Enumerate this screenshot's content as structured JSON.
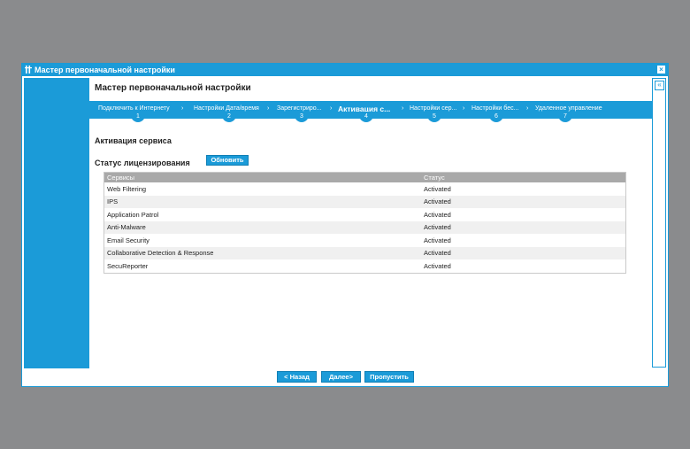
{
  "window": {
    "title": "Мастер первоначальной настройки",
    "close_glyph": "×",
    "wand_icon": "wizard-icon"
  },
  "header": {
    "title": "Мастер первоначальной настройки"
  },
  "steps": [
    {
      "label": "Подключить к Интернету",
      "number": "1"
    },
    {
      "label": "Настройки Дата/время",
      "number": "2"
    },
    {
      "label": "Зарегистриро...",
      "number": "3"
    },
    {
      "label": "Активация с...",
      "number": "4",
      "active": true
    },
    {
      "label": "Настройки сер...",
      "number": "5"
    },
    {
      "label": "Настройки бес...",
      "number": "6"
    },
    {
      "label": "Удаленное управление",
      "number": "7"
    }
  ],
  "section": {
    "title": "Активация сервиса",
    "license_label": "Статус лицензирования",
    "refresh_label": "Обновить"
  },
  "table": {
    "headers": [
      "Сервисы",
      "Статус"
    ],
    "rows": [
      [
        "Web Filtering",
        "Activated"
      ],
      [
        "IPS",
        "Activated"
      ],
      [
        "Application Patrol",
        "Activated"
      ],
      [
        "Anti-Malware",
        "Activated"
      ],
      [
        "Email Security",
        "Activated"
      ],
      [
        "Collaborative Detection & Response",
        "Activated"
      ],
      [
        "SecuReporter",
        "Activated"
      ]
    ]
  },
  "footer": {
    "back_label": "< Назад",
    "next_label": "Далее>",
    "skip_label": "Пропустить"
  },
  "colors": {
    "accent": "#1b9bd8",
    "background": "#8a8b8d",
    "header_gray": "#a9a9a9"
  }
}
